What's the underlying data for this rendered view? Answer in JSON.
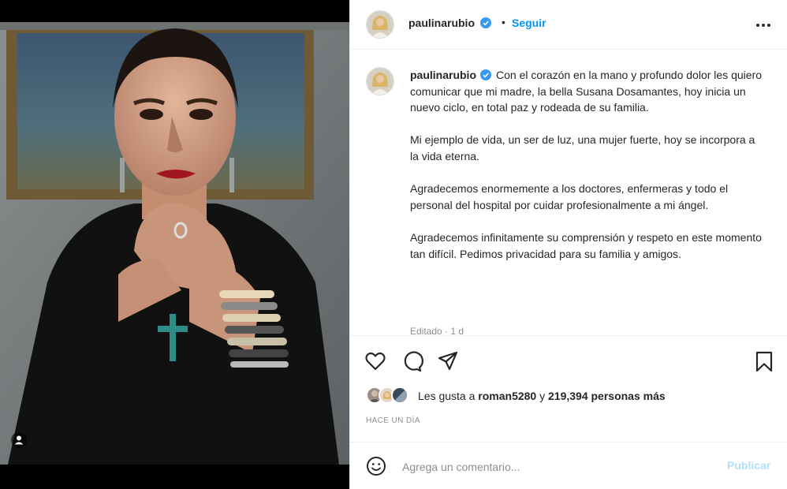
{
  "post": {
    "username": "paulinarubio",
    "dot": "•",
    "follow_label": "Seguir",
    "caption_paragraphs": [
      "Con el corazón en la mano y profundo dolor les quiero comunicar que mi madre, la bella Susana Dosamantes, hoy inicia un nuevo ciclo, en total paz y rodeada de su familia.",
      "Mi ejemplo de vida, un ser de luz, una mujer fuerte, hoy se incorpora a la vida eterna.",
      "Agradecemos enormemente a los doctores, enfermeras y todo el personal del hospital por cuidar profesionalmente a mi ángel.",
      "Agradecemos infinitamente su comprensión y respeto en este momento tan difícil. Pedimos privacidad para su familia y amigos."
    ],
    "edited": "Editado · 1 d",
    "likes": {
      "prefix": "Les gusta a",
      "user": "roman5280",
      "connector": "y",
      "count": "219,394 personas más"
    },
    "timestamp": "HACE UN DÍA"
  },
  "comment": {
    "placeholder": "Agrega un comentario...",
    "publish_label": "Publicar"
  },
  "colors": {
    "link_blue": "#0095f6",
    "publish_disabled": "#b2dffc",
    "verified_blue": "#3897f0"
  },
  "icons": [
    "tag-person-icon",
    "more-options-icon",
    "heart-icon",
    "comment-icon",
    "share-icon",
    "bookmark-icon",
    "emoji-icon",
    "verified-badge-icon"
  ]
}
